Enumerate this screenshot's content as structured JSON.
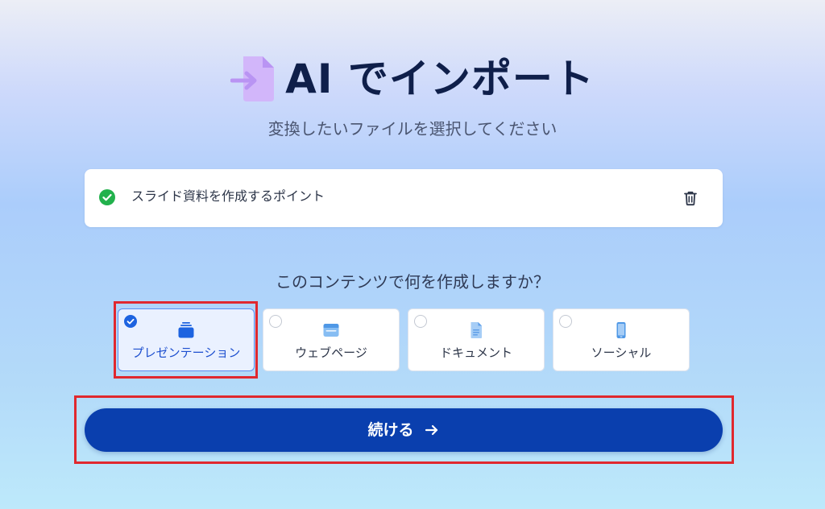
{
  "header": {
    "title": "AI でインポート",
    "subtitle": "変換したいファイルを選択してください"
  },
  "file": {
    "name": "スライド資料を作成するポイント",
    "status_icon": "check-circle-icon",
    "delete_icon": "trash-icon"
  },
  "question": "このコンテンツで何を作成しますか？",
  "options": [
    {
      "label": "プレゼンテーション",
      "icon": "presentation-icon",
      "selected": true
    },
    {
      "label": "ウェブページ",
      "icon": "webpage-icon",
      "selected": false
    },
    {
      "label": "ドキュメント",
      "icon": "document-icon",
      "selected": false
    },
    {
      "label": "ソーシャル",
      "icon": "mobile-icon",
      "selected": false
    }
  ],
  "continue_button": {
    "label": "続ける",
    "icon": "arrow-right-icon"
  },
  "colors": {
    "primary": "#0a3fae",
    "selected_text": "#1d4fcf",
    "success": "#22b14c",
    "highlight": "#e0282e",
    "title_icon": "#c9a6f7"
  }
}
